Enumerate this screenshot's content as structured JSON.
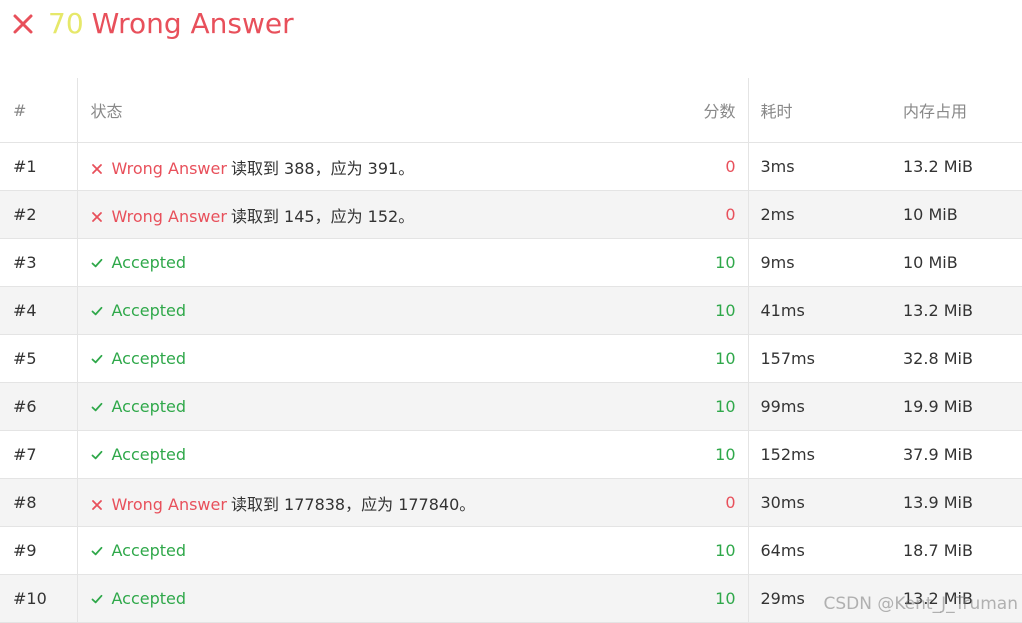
{
  "header": {
    "score": "70",
    "result": "Wrong Answer"
  },
  "columns": {
    "index": "#",
    "status": "状态",
    "score": "分数",
    "time": "耗时",
    "memory": "内存占用"
  },
  "rows": [
    {
      "index": "#1",
      "verdict": "wa",
      "status": "Wrong Answer",
      "detail": "读取到 388，应为 391。",
      "score": "0",
      "time": "3ms",
      "memory": "13.2 MiB"
    },
    {
      "index": "#2",
      "verdict": "wa",
      "status": "Wrong Answer",
      "detail": "读取到 145，应为 152。",
      "score": "0",
      "time": "2ms",
      "memory": "10 MiB"
    },
    {
      "index": "#3",
      "verdict": "ac",
      "status": "Accepted",
      "detail": "",
      "score": "10",
      "time": "9ms",
      "memory": "10 MiB"
    },
    {
      "index": "#4",
      "verdict": "ac",
      "status": "Accepted",
      "detail": "",
      "score": "10",
      "time": "41ms",
      "memory": "13.2 MiB"
    },
    {
      "index": "#5",
      "verdict": "ac",
      "status": "Accepted",
      "detail": "",
      "score": "10",
      "time": "157ms",
      "memory": "32.8 MiB"
    },
    {
      "index": "#6",
      "verdict": "ac",
      "status": "Accepted",
      "detail": "",
      "score": "10",
      "time": "99ms",
      "memory": "19.9 MiB"
    },
    {
      "index": "#7",
      "verdict": "ac",
      "status": "Accepted",
      "detail": "",
      "score": "10",
      "time": "152ms",
      "memory": "37.9 MiB"
    },
    {
      "index": "#8",
      "verdict": "wa",
      "status": "Wrong Answer",
      "detail": "读取到 177838，应为 177840。",
      "score": "0",
      "time": "30ms",
      "memory": "13.9 MiB"
    },
    {
      "index": "#9",
      "verdict": "ac",
      "status": "Accepted",
      "detail": "",
      "score": "10",
      "time": "64ms",
      "memory": "18.7 MiB"
    },
    {
      "index": "#10",
      "verdict": "ac",
      "status": "Accepted",
      "detail": "",
      "score": "10",
      "time": "29ms",
      "memory": "13.2 MiB"
    }
  ],
  "colors": {
    "wrong": "#e8505b",
    "accepted": "#2fa84a",
    "score_accent": "#e6e86a"
  },
  "icons": {
    "wrong": "close-icon",
    "accepted": "check-icon"
  },
  "watermark": "CSDN @Kent_J_Truman"
}
